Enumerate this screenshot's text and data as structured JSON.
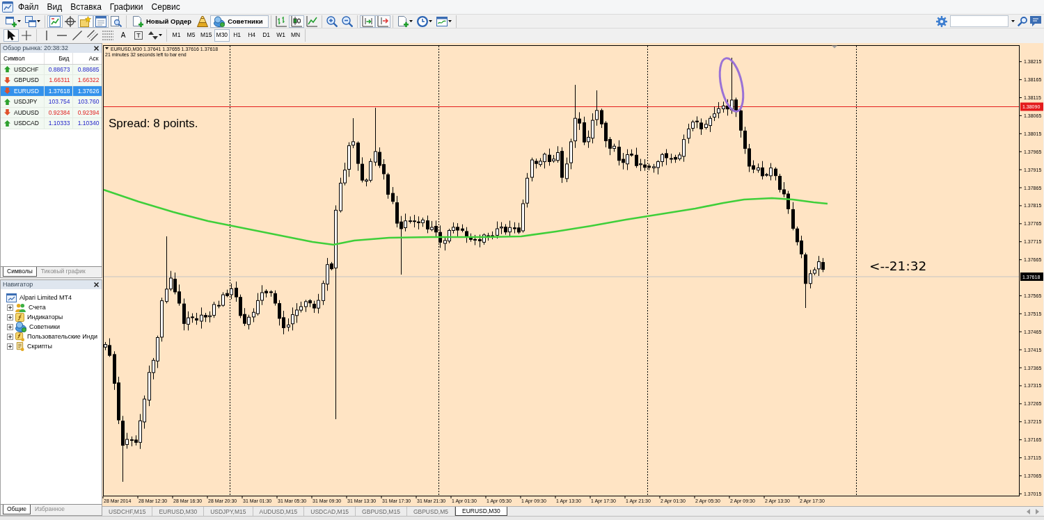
{
  "menu": [
    "Файл",
    "Вид",
    "Вставка",
    "Графики",
    "Сервис"
  ],
  "toolbar": [
    [
      {
        "kind": "icon",
        "pressed": false
      },
      {
        "kind": "icon",
        "pressed": false
      }
    ],
    [
      {
        "kind": "icon",
        "pressed": true
      },
      {
        "kind": "icon",
        "pressed": false
      },
      {
        "kind": "icon",
        "pressed": true
      },
      {
        "kind": "icon",
        "pressed": true
      },
      {
        "kind": "icon",
        "pressed": false
      }
    ],
    [
      {
        "kind": "text-button",
        "label": "Новый Ордер",
        "pressed": false
      },
      {
        "kind": "icon",
        "pressed": false
      },
      {
        "kind": "text-button",
        "label": "Советники",
        "pressed": true
      }
    ],
    [
      {
        "kind": "icon",
        "pressed": false
      },
      {
        "kind": "icon",
        "pressed": true
      },
      {
        "kind": "icon",
        "pressed": false
      }
    ],
    [
      {
        "kind": "icon",
        "pressed": false
      },
      {
        "kind": "icon",
        "pressed": false
      }
    ],
    [
      {
        "kind": "icon",
        "pressed": true
      },
      {
        "kind": "icon",
        "pressed": true
      }
    ],
    [
      {
        "kind": "icon",
        "pressed": false
      },
      {
        "kind": "icon",
        "pressed": false
      },
      {
        "kind": "icon",
        "pressed": false
      }
    ]
  ],
  "drawing_toolbar": [
    [
      {
        "kind": "icon",
        "pressed": true
      },
      {
        "kind": "icon",
        "pressed": false
      }
    ],
    [
      {
        "kind": "icon",
        "pressed": false
      },
      {
        "kind": "icon",
        "pressed": false
      },
      {
        "kind": "icon",
        "pressed": false
      },
      {
        "kind": "icon",
        "pressed": false
      },
      {
        "kind": "icon",
        "pressed": false
      },
      {
        "kind": "letter",
        "label": "A",
        "pressed": false
      },
      {
        "kind": "framed-letter",
        "label": "T",
        "pressed": false
      },
      {
        "kind": "icon",
        "pressed": false
      }
    ]
  ],
  "timeframes": [
    {
      "label": "M1",
      "selected": false
    },
    {
      "label": "M5",
      "selected": false
    },
    {
      "label": "M15",
      "selected": false
    },
    {
      "label": "M30",
      "selected": true
    },
    {
      "label": "H1",
      "selected": false
    },
    {
      "label": "H4",
      "selected": false
    },
    {
      "label": "D1",
      "selected": false
    },
    {
      "label": "W1",
      "selected": false
    },
    {
      "label": "MN",
      "selected": false
    }
  ],
  "market_watch": {
    "title": "Обзор рынка: 20:38:32",
    "columns": [
      "Символ",
      "Бид",
      "Аск"
    ],
    "rows": [
      {
        "symbol": "USDCHF",
        "bid": "0.88673",
        "ask": "0.88685",
        "rising": true,
        "selected": false
      },
      {
        "symbol": "GBPUSD",
        "bid": "1.66311",
        "ask": "1.66322",
        "rising": false,
        "selected": false
      },
      {
        "symbol": "EURUSD",
        "bid": "1.37618",
        "ask": "1.37626",
        "rising": false,
        "selected": true
      },
      {
        "symbol": "USDJPY",
        "bid": "103.754",
        "ask": "103.760",
        "rising": true,
        "selected": false
      },
      {
        "symbol": "AUDUSD",
        "bid": "0.92384",
        "ask": "0.92394",
        "rising": false,
        "selected": false
      },
      {
        "symbol": "USDCAD",
        "bid": "1.10333",
        "ask": "1.10340",
        "rising": true,
        "selected": false
      }
    ],
    "tabs": [
      {
        "label": "Символы",
        "selected": true
      },
      {
        "label": "Тиковый график",
        "selected": false
      }
    ]
  },
  "navigator": {
    "title": "Навигатор",
    "tree": [
      {
        "label": "Alpari Limited MT4",
        "children": [
          {
            "label": "Счета",
            "expanded": false
          },
          {
            "label": "Индикаторы",
            "expanded": false
          },
          {
            "label": "Советники",
            "expanded": false
          },
          {
            "label": "Пользовательские Инди",
            "expanded": false
          },
          {
            "label": "Скрипты",
            "expanded": false
          }
        ]
      }
    ],
    "tabs": [
      {
        "label": "Общие",
        "selected": true
      },
      {
        "label": "Избранное",
        "selected": false
      }
    ]
  },
  "chart": {
    "header": "EURUSD,M30 1.37641 1.37655 1.37616 1.37618",
    "timer": "21 minutes 32 seconds left to bar end",
    "annotations": [
      {
        "text": "Spread: 8 points."
      },
      {
        "text": "<--21:32"
      }
    ],
    "price_ticks": [
      "1.38215",
      "1.38165",
      "1.38115",
      "1.38065",
      "1.38015",
      "1.37965",
      "1.37915",
      "1.37865",
      "1.37815",
      "1.37765",
      "1.37715",
      "1.37665",
      "1.37565",
      "1.37515",
      "1.37465",
      "1.37415",
      "1.37365",
      "1.37315",
      "1.37265",
      "1.37215",
      "1.37165",
      "1.37115",
      "1.37065",
      "1.37015"
    ],
    "price_labels": [
      {
        "text": "1.38090",
        "kind": "level"
      },
      {
        "text": "1.37618",
        "kind": "bid"
      }
    ],
    "time_ticks": [
      "28 Mar 2014",
      "28 Mar 12:30",
      "28 Mar 16:30",
      "28 Mar 20:30",
      "31 Mar 01:30",
      "31 Mar 05:30",
      "31 Mar 09:30",
      "31 Mar 13:30",
      "31 Mar 17:30",
      "31 Mar 21:30",
      "1 Apr 01:30",
      "1 Apr 05:30",
      "1 Apr 09:30",
      "1 Apr 13:30",
      "1 Apr 17:30",
      "1 Apr 21:30",
      "2 Apr 01:30",
      "2 Apr 05:30",
      "2 Apr 09:30",
      "2 Apr 13:30",
      "2 Apr 17:30"
    ]
  },
  "chart_tabs": [
    {
      "label": "USDCHF,M15",
      "selected": false
    },
    {
      "label": "EURUSD,M30",
      "selected": false
    },
    {
      "label": "USDJPY,M15",
      "selected": false
    },
    {
      "label": "AUDUSD,M15",
      "selected": false
    },
    {
      "label": "USDCAD,M15",
      "selected": false
    },
    {
      "label": "GBPUSD,M15",
      "selected": false
    },
    {
      "label": "GBPUSD,M5",
      "selected": false
    },
    {
      "label": "EURUSD,M30",
      "selected": true
    }
  ]
}
